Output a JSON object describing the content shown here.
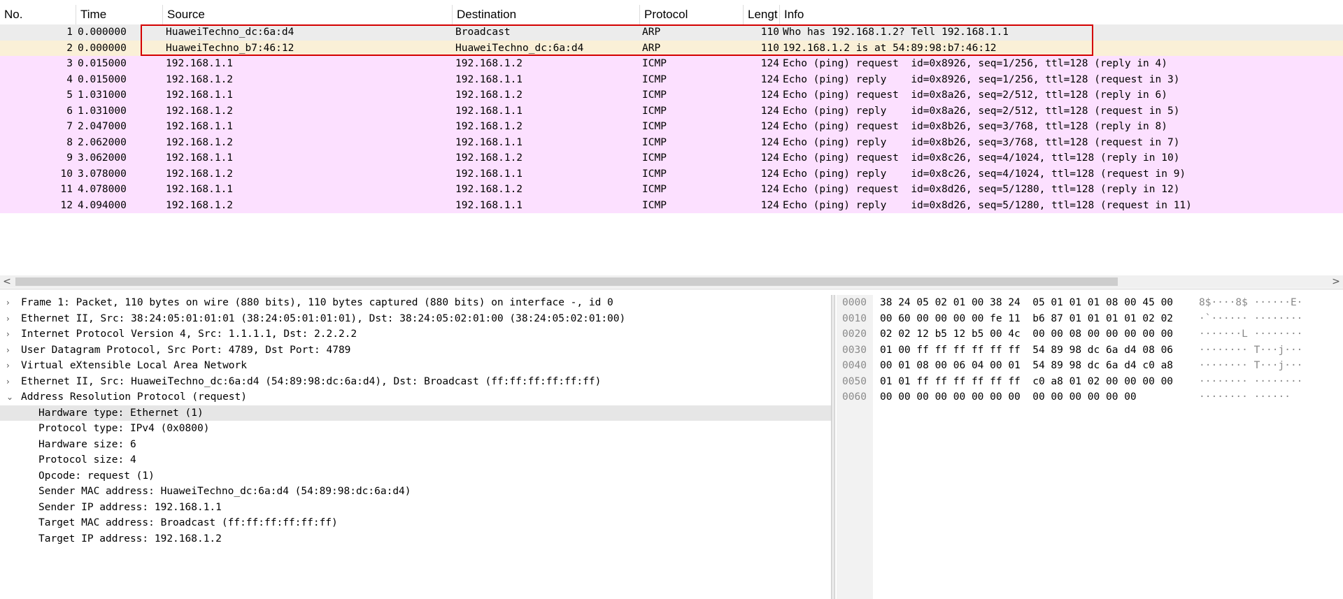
{
  "packet_list": {
    "columns": [
      "No.",
      "Time",
      "Source",
      "Destination",
      "Protocol",
      "Lengt",
      "Info"
    ],
    "rows": [
      {
        "no": "1",
        "time": "0.000000",
        "src": "HuaweiTechno_dc:6a:d4",
        "dst": "Broadcast",
        "proto": "ARP",
        "len": "110",
        "info": "Who has 192.168.1.2? Tell 192.168.1.1",
        "bg": "#ececec"
      },
      {
        "no": "2",
        "time": "0.000000",
        "src": "HuaweiTechno_b7:46:12",
        "dst": "HuaweiTechno_dc:6a:d4",
        "proto": "ARP",
        "len": "110",
        "info": "192.168.1.2 is at 54:89:98:b7:46:12",
        "bg": "#faf0d7"
      },
      {
        "no": "3",
        "time": "0.015000",
        "src": "192.168.1.1",
        "dst": "192.168.1.2",
        "proto": "ICMP",
        "len": "124",
        "info": "Echo (ping) request  id=0x8926, seq=1/256, ttl=128 (reply in 4)",
        "bg": "#fce0ff"
      },
      {
        "no": "4",
        "time": "0.015000",
        "src": "192.168.1.2",
        "dst": "192.168.1.1",
        "proto": "ICMP",
        "len": "124",
        "info": "Echo (ping) reply    id=0x8926, seq=1/256, ttl=128 (request in 3)",
        "bg": "#fce0ff"
      },
      {
        "no": "5",
        "time": "1.031000",
        "src": "192.168.1.1",
        "dst": "192.168.1.2",
        "proto": "ICMP",
        "len": "124",
        "info": "Echo (ping) request  id=0x8a26, seq=2/512, ttl=128 (reply in 6)",
        "bg": "#fce0ff"
      },
      {
        "no": "6",
        "time": "1.031000",
        "src": "192.168.1.2",
        "dst": "192.168.1.1",
        "proto": "ICMP",
        "len": "124",
        "info": "Echo (ping) reply    id=0x8a26, seq=2/512, ttl=128 (request in 5)",
        "bg": "#fce0ff"
      },
      {
        "no": "7",
        "time": "2.047000",
        "src": "192.168.1.1",
        "dst": "192.168.1.2",
        "proto": "ICMP",
        "len": "124",
        "info": "Echo (ping) request  id=0x8b26, seq=3/768, ttl=128 (reply in 8)",
        "bg": "#fce0ff"
      },
      {
        "no": "8",
        "time": "2.062000",
        "src": "192.168.1.2",
        "dst": "192.168.1.1",
        "proto": "ICMP",
        "len": "124",
        "info": "Echo (ping) reply    id=0x8b26, seq=3/768, ttl=128 (request in 7)",
        "bg": "#fce0ff"
      },
      {
        "no": "9",
        "time": "3.062000",
        "src": "192.168.1.1",
        "dst": "192.168.1.2",
        "proto": "ICMP",
        "len": "124",
        "info": "Echo (ping) request  id=0x8c26, seq=4/1024, ttl=128 (reply in 10)",
        "bg": "#fce0ff"
      },
      {
        "no": "10",
        "time": "3.078000",
        "src": "192.168.1.2",
        "dst": "192.168.1.1",
        "proto": "ICMP",
        "len": "124",
        "info": "Echo (ping) reply    id=0x8c26, seq=4/1024, ttl=128 (request in 9)",
        "bg": "#fce0ff"
      },
      {
        "no": "11",
        "time": "4.078000",
        "src": "192.168.1.1",
        "dst": "192.168.1.2",
        "proto": "ICMP",
        "len": "124",
        "info": "Echo (ping) request  id=0x8d26, seq=5/1280, ttl=128 (reply in 12)",
        "bg": "#fce0ff"
      },
      {
        "no": "12",
        "time": "4.094000",
        "src": "192.168.1.2",
        "dst": "192.168.1.1",
        "proto": "ICMP",
        "len": "124",
        "info": "Echo (ping) reply    id=0x8d26, seq=5/1280, ttl=128 (request in 11)",
        "bg": "#fce0ff"
      }
    ],
    "highlight_color": "#d40000"
  },
  "scrollbar": {
    "left_arrow": "<",
    "right_arrow": ">"
  },
  "details": [
    {
      "text": "Frame 1: Packet, 110 bytes on wire (880 bits), 110 bytes captured (880 bits) on interface -, id 0",
      "level": 0,
      "arrow": "›"
    },
    {
      "text": "Ethernet II, Src: 38:24:05:01:01:01 (38:24:05:01:01:01), Dst: 38:24:05:02:01:00 (38:24:05:02:01:00)",
      "level": 0,
      "arrow": "›"
    },
    {
      "text": "Internet Protocol Version 4, Src: 1.1.1.1, Dst: 2.2.2.2",
      "level": 0,
      "arrow": "›"
    },
    {
      "text": "User Datagram Protocol, Src Port: 4789, Dst Port: 4789",
      "level": 0,
      "arrow": "›"
    },
    {
      "text": "Virtual eXtensible Local Area Network",
      "level": 0,
      "arrow": "›"
    },
    {
      "text": "Ethernet II, Src: HuaweiTechno_dc:6a:d4 (54:89:98:dc:6a:d4), Dst: Broadcast (ff:ff:ff:ff:ff:ff)",
      "level": 0,
      "arrow": "›"
    },
    {
      "text": "Address Resolution Protocol (request)",
      "level": 0,
      "arrow": "⌄"
    },
    {
      "text": "Hardware type: Ethernet (1)",
      "level": 1,
      "arrow": "",
      "selected": true
    },
    {
      "text": "Protocol type: IPv4 (0x0800)",
      "level": 1,
      "arrow": ""
    },
    {
      "text": "Hardware size: 6",
      "level": 1,
      "arrow": ""
    },
    {
      "text": "Protocol size: 4",
      "level": 1,
      "arrow": ""
    },
    {
      "text": "Opcode: request (1)",
      "level": 1,
      "arrow": ""
    },
    {
      "text": "Sender MAC address: HuaweiTechno_dc:6a:d4 (54:89:98:dc:6a:d4)",
      "level": 1,
      "arrow": ""
    },
    {
      "text": "Sender IP address: 192.168.1.1",
      "level": 1,
      "arrow": ""
    },
    {
      "text": "Target MAC address: Broadcast (ff:ff:ff:ff:ff:ff)",
      "level": 1,
      "arrow": ""
    },
    {
      "text": "Target IP address: 192.168.1.2",
      "level": 1,
      "arrow": ""
    }
  ],
  "bytes": [
    {
      "off": "0000",
      "hex": "38 24 05 02 01 00 38 24  05 01 01 01 08 00 45 00",
      "asc": "8$····8$ ······E·"
    },
    {
      "off": "0010",
      "hex": "00 60 00 00 00 00 fe 11  b6 87 01 01 01 01 02 02",
      "asc": "·`······ ········"
    },
    {
      "off": "0020",
      "hex": "02 02 12 b5 12 b5 00 4c  00 00 08 00 00 00 00 00",
      "asc": "·······L ········"
    },
    {
      "off": "0030",
      "hex": "01 00 ff ff ff ff ff ff  54 89 98 dc 6a d4 08 06",
      "asc": "········ T···j···"
    },
    {
      "off": "0040",
      "hex": "00 01 08 00 06 04 00 01  54 89 98 dc 6a d4 c0 a8",
      "asc": "········ T···j···"
    },
    {
      "off": "0050",
      "hex": "01 01 ff ff ff ff ff ff  c0 a8 01 02 00 00 00 00",
      "asc": "········ ········"
    },
    {
      "off": "0060",
      "hex": "00 00 00 00 00 00 00 00  00 00 00 00 00 00",
      "asc": "········ ······"
    }
  ]
}
